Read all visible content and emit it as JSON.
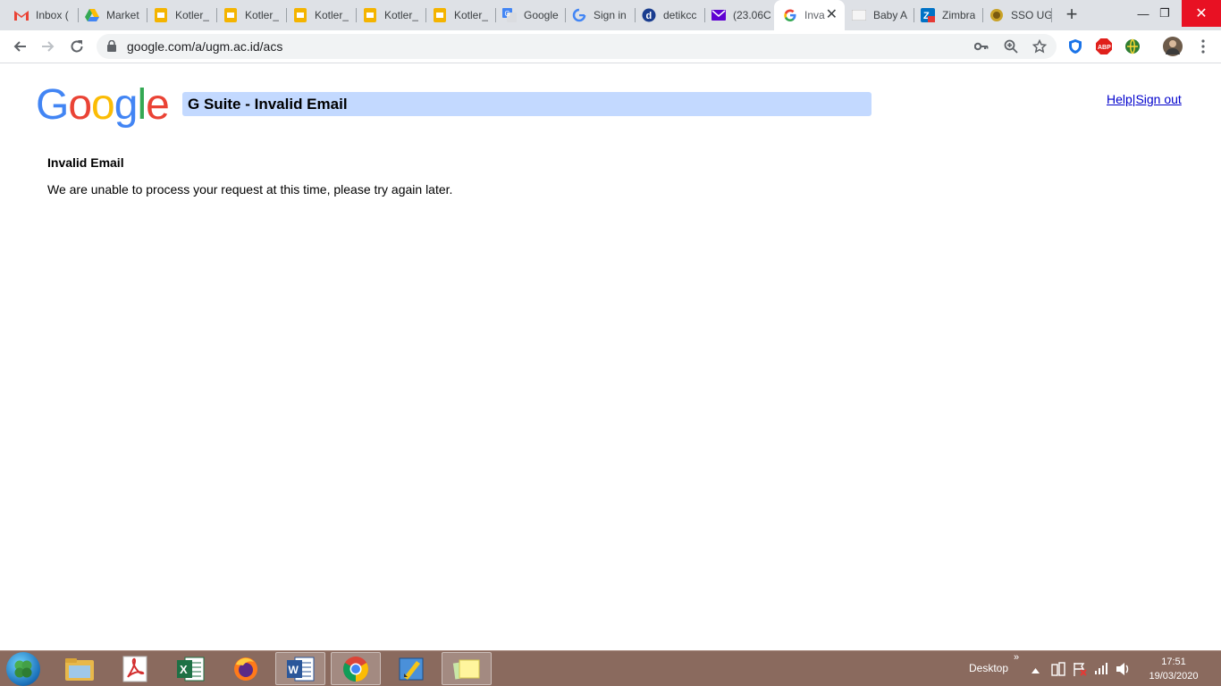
{
  "tabs": [
    {
      "title": "Inbox (",
      "icon": "gmail-icon"
    },
    {
      "title": "Market",
      "icon": "google-drive-icon"
    },
    {
      "title": "Kotler_",
      "icon": "google-slides-icon"
    },
    {
      "title": "Kotler_",
      "icon": "google-slides-icon"
    },
    {
      "title": "Kotler_",
      "icon": "google-slides-icon"
    },
    {
      "title": "Kotler_",
      "icon": "google-slides-icon"
    },
    {
      "title": "Kotler_",
      "icon": "google-slides-icon"
    },
    {
      "title": "Google",
      "icon": "google-translate-icon"
    },
    {
      "title": "Sign in",
      "icon": "google-g-icon"
    },
    {
      "title": "detikcc",
      "icon": "detik-icon"
    },
    {
      "title": "(23.06C",
      "icon": "yahoo-mail-icon"
    },
    {
      "title": "Inva",
      "icon": "google-g-icon",
      "active": true
    },
    {
      "title": "Baby A",
      "icon": "site-favicon-icon"
    },
    {
      "title": "Zimbra",
      "icon": "zimbra-icon"
    },
    {
      "title": "SSO UG",
      "icon": "ugm-seal-icon"
    }
  ],
  "address_bar": {
    "url": "google.com/a/ugm.ac.id/acs"
  },
  "page": {
    "logo": [
      "G",
      "o",
      "o",
      "g",
      "l",
      "e"
    ],
    "logo_colors": [
      "#4285f4",
      "#ea4335",
      "#fbbc05",
      "#4285f4",
      "#34a853",
      "#ea4335"
    ],
    "title": "G Suite - Invalid Email",
    "help_link": "Help",
    "link_separator": "|",
    "signout_link": "Sign out",
    "error_heading": "Invalid Email",
    "error_message": "We are unable to process your request at this time, please try again later."
  },
  "taskbar": {
    "apps": [
      "file-explorer-icon",
      "acrobat-icon",
      "excel-icon",
      "firefox-icon",
      "word-icon",
      "chrome-icon",
      "paint-icon",
      "sticky-notes-icon"
    ],
    "desktop_label": "Desktop",
    "desktop_chevron": "»",
    "time": "17:51",
    "date": "19/03/2020"
  },
  "colors": {
    "tab_strip": "#dee1e6",
    "title_bar": "#c3d9ff",
    "link": "#0000cc",
    "taskbar": "#8a6a5e"
  }
}
